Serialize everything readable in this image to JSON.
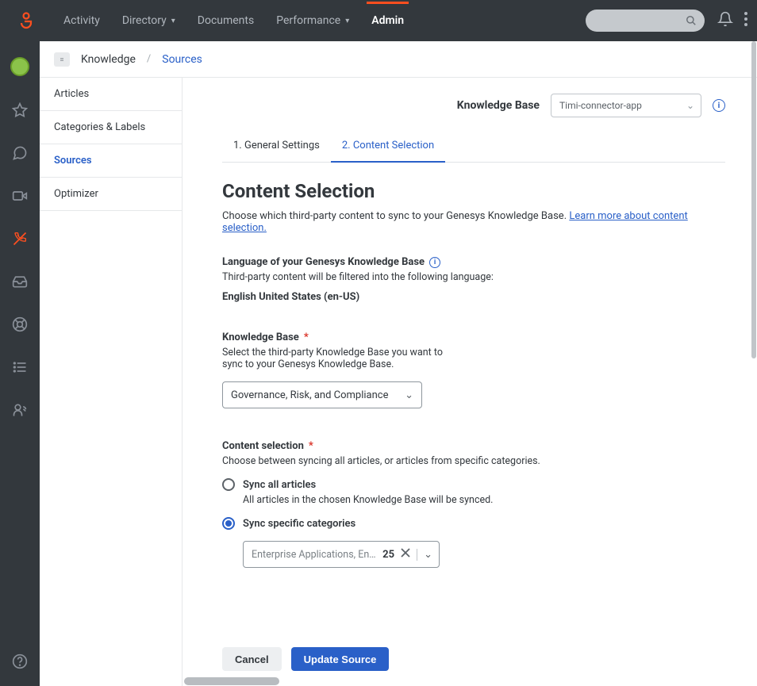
{
  "topnav": {
    "items": [
      "Activity",
      "Directory",
      "Documents",
      "Performance",
      "Admin"
    ],
    "active": "Admin"
  },
  "breadcrumb": {
    "root": "Knowledge",
    "current": "Sources"
  },
  "subnav": {
    "items": [
      "Articles",
      "Categories & Labels",
      "Sources",
      "Optimizer"
    ],
    "active": "Sources"
  },
  "kb_selector": {
    "label": "Knowledge Base",
    "value": "Timi-connector-app"
  },
  "tabs": {
    "items": [
      "1. General Settings",
      "2. Content Selection"
    ],
    "active": "2. Content Selection"
  },
  "page": {
    "title": "Content Selection",
    "subtitle_prefix": "Choose which third-party content to sync to your Genesys Knowledge Base. ",
    "subtitle_link": "Learn more about content selection."
  },
  "lang": {
    "label": "Language of your Genesys Knowledge Base",
    "help": "Third-party content will be filtered into the following language:",
    "value": "English United States (en-US)"
  },
  "kb_field": {
    "label": "Knowledge Base",
    "help1": "Select the third-party Knowledge Base you want to",
    "help2": "sync to your Genesys Knowledge Base.",
    "value": "Governance, Risk, and Compliance"
  },
  "content_sel": {
    "label": "Content selection",
    "help": "Choose between syncing all articles, or articles from specific categories.",
    "opt_all_label": "Sync all articles",
    "opt_all_help": "All articles in the chosen Knowledge Base will be synced.",
    "opt_cat_label": "Sync specific categories",
    "cat_value": "Enterprise Applications, Enterpris…",
    "cat_count": "25"
  },
  "buttons": {
    "cancel": "Cancel",
    "update": "Update Source"
  },
  "colors": {
    "accent": "#ff4f1f",
    "link": "#2a60c8"
  }
}
